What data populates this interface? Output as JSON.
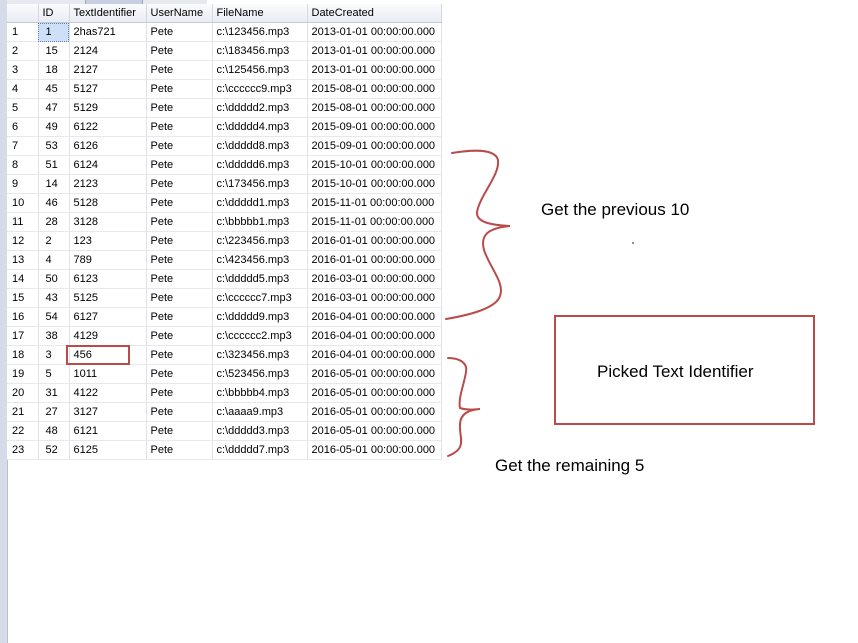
{
  "grid": {
    "columns": [
      "",
      "ID",
      "TextIdentifier",
      "UserName",
      "FileName",
      "DateCreated"
    ],
    "rows": [
      [
        "1",
        "1",
        "2has721",
        "Pete",
        "c:\\123456.mp3",
        "2013-01-01 00:00:00.000"
      ],
      [
        "2",
        "15",
        "2124",
        "Pete",
        "c:\\183456.mp3",
        "2013-01-01 00:00:00.000"
      ],
      [
        "3",
        "18",
        "2127",
        "Pete",
        "c:\\125456.mp3",
        "2013-01-01 00:00:00.000"
      ],
      [
        "4",
        "45",
        "5127",
        "Pete",
        "c:\\cccccc9.mp3",
        "2015-08-01 00:00:00.000"
      ],
      [
        "5",
        "47",
        "5129",
        "Pete",
        "c:\\ddddd2.mp3",
        "2015-08-01 00:00:00.000"
      ],
      [
        "6",
        "49",
        "6122",
        "Pete",
        "c:\\ddddd4.mp3",
        "2015-09-01 00:00:00.000"
      ],
      [
        "7",
        "53",
        "6126",
        "Pete",
        "c:\\ddddd8.mp3",
        "2015-09-01 00:00:00.000"
      ],
      [
        "8",
        "51",
        "6124",
        "Pete",
        "c:\\ddddd6.mp3",
        "2015-10-01 00:00:00.000"
      ],
      [
        "9",
        "14",
        "2123",
        "Pete",
        "c:\\173456.mp3",
        "2015-10-01 00:00:00.000"
      ],
      [
        "10",
        "46",
        "5128",
        "Pete",
        "c:\\ddddd1.mp3",
        "2015-11-01 00:00:00.000"
      ],
      [
        "11",
        "28",
        "3128",
        "Pete",
        "c:\\bbbbb1.mp3",
        "2015-11-01 00:00:00.000"
      ],
      [
        "12",
        "2",
        "123",
        "Pete",
        "c:\\223456.mp3",
        "2016-01-01 00:00:00.000"
      ],
      [
        "13",
        "4",
        "789",
        "Pete",
        "c:\\423456.mp3",
        "2016-01-01 00:00:00.000"
      ],
      [
        "14",
        "50",
        "6123",
        "Pete",
        "c:\\ddddd5.mp3",
        "2016-03-01 00:00:00.000"
      ],
      [
        "15",
        "43",
        "5125",
        "Pete",
        "c:\\cccccc7.mp3",
        "2016-03-01 00:00:00.000"
      ],
      [
        "16",
        "54",
        "6127",
        "Pete",
        "c:\\ddddd9.mp3",
        "2016-04-01 00:00:00.000"
      ],
      [
        "17",
        "38",
        "4129",
        "Pete",
        "c:\\cccccc2.mp3",
        "2016-04-01 00:00:00.000"
      ],
      [
        "18",
        "3",
        "456",
        "Pete",
        "c:\\323456.mp3",
        "2016-04-01 00:00:00.000"
      ],
      [
        "19",
        "5",
        "1011",
        "Pete",
        "c:\\523456.mp3",
        "2016-05-01 00:00:00.000"
      ],
      [
        "20",
        "31",
        "4122",
        "Pete",
        "c:\\bbbbb4.mp3",
        "2016-05-01 00:00:00.000"
      ],
      [
        "21",
        "27",
        "3127",
        "Pete",
        "c:\\aaaa9.mp3",
        "2016-05-01 00:00:00.000"
      ],
      [
        "22",
        "48",
        "6121",
        "Pete",
        "c:\\ddddd3.mp3",
        "2016-05-01 00:00:00.000"
      ],
      [
        "23",
        "52",
        "6125",
        "Pete",
        "c:\\ddddd7.mp3",
        "2016-05-01 00:00:00.000"
      ]
    ],
    "selected_cell": {
      "row": 1,
      "column": "ID"
    }
  },
  "annotations": {
    "previous_label": "Get the previous 10",
    "picked_label": "Picked Text Identifier",
    "remaining_label": "Get the remaining 5",
    "highlighted_row": 18,
    "ink_color": "#b94b4b"
  }
}
